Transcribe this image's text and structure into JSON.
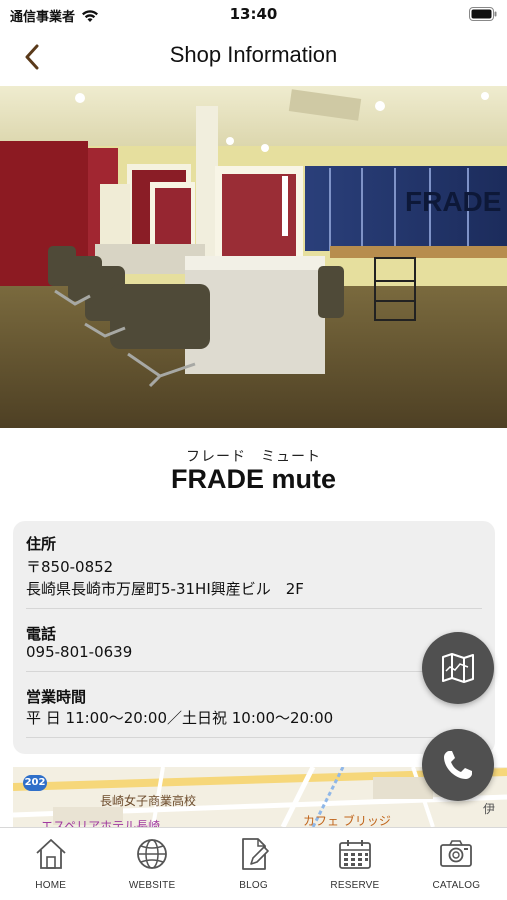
{
  "status_bar": {
    "carrier": "通信事業者",
    "time": "13:40"
  },
  "nav": {
    "title": "Shop Information",
    "back_icon": "chevron-left-icon"
  },
  "shop": {
    "kana": "フレード　ミュート",
    "name": "FRADE mute",
    "photo_sign_text": "FRADE"
  },
  "info": {
    "address": {
      "label": "住所",
      "postal": "〒850-0852",
      "line": "長崎県長崎市万屋町5-31HI興産ビル　2F"
    },
    "phone": {
      "label": "電話",
      "value": "095-801-0639"
    },
    "hours": {
      "label": "営業時間",
      "value": "平 日 11:00～20:00／土日祝 10:00～20:00"
    }
  },
  "map": {
    "route_number": "202",
    "labels": {
      "school": "長崎女子商業高校",
      "hotel": "エスペリアホテル長崎",
      "cafe": "カフェ ブリッジ",
      "edge": "伊"
    }
  },
  "fab": {
    "map_icon": "map-icon",
    "call_icon": "phone-icon"
  },
  "tabs": [
    {
      "label": "HOME",
      "icon": "home-icon"
    },
    {
      "label": "WEBSITE",
      "icon": "globe-icon"
    },
    {
      "label": "BLOG",
      "icon": "blog-edit-icon"
    },
    {
      "label": "RESERVE",
      "icon": "calendar-icon"
    },
    {
      "label": "CATALOG",
      "icon": "camera-icon"
    }
  ],
  "colors": {
    "fab_background": "#505050",
    "card_background": "#efefef",
    "tab_icon": "#555555"
  }
}
